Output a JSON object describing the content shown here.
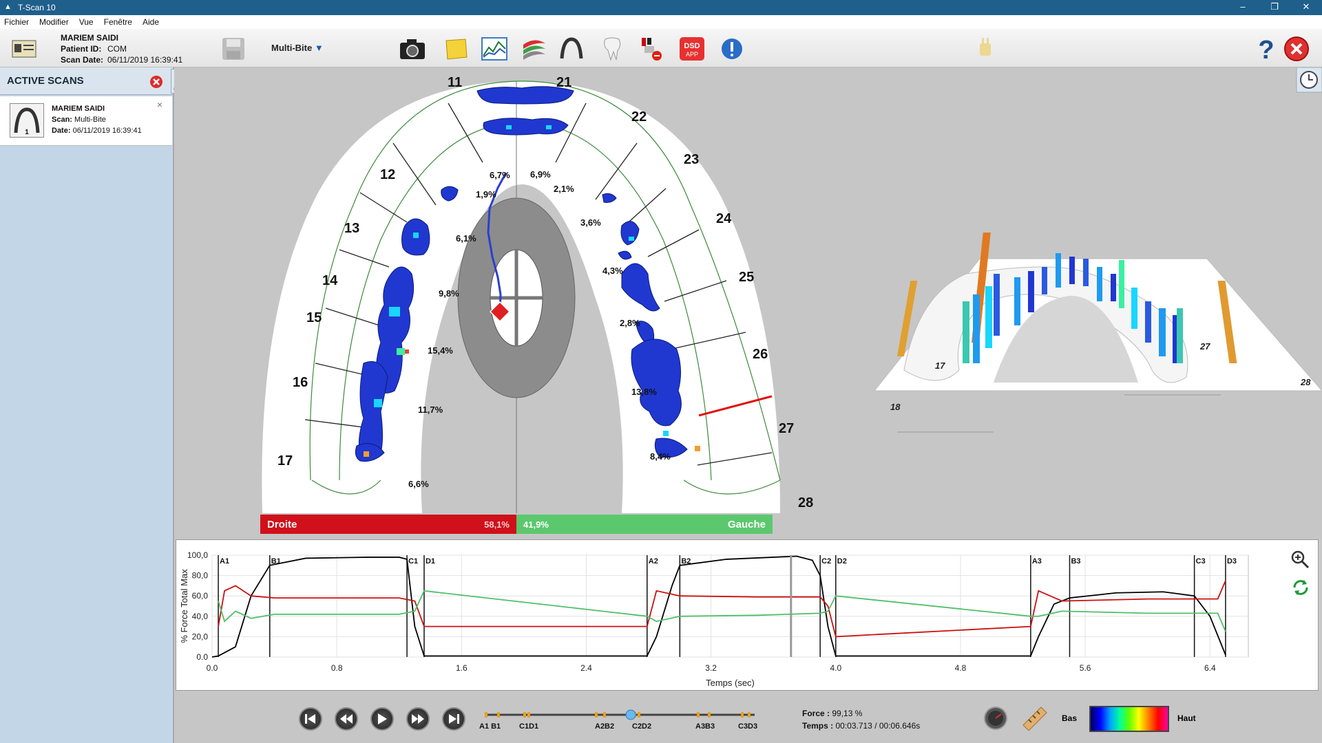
{
  "window": {
    "title": "T-Scan 10",
    "minimize": "–",
    "restore": "❐",
    "close": "✕"
  },
  "menu": [
    "Fichier",
    "Modifier",
    "Vue",
    "Fenêtre",
    "Aide"
  ],
  "patient": {
    "name": "MARIEM SAIDI",
    "id_label": "Patient ID:",
    "id": "COM",
    "date_label": "Scan Date:",
    "date": "06/11/2019 16:39:41"
  },
  "toolbar": {
    "mode": "Multi-Bite"
  },
  "active_scans": {
    "title": "ACTIVE SCANS",
    "card": {
      "name": "MARIEM SAIDI",
      "scan_label": "Scan:",
      "scan": "Multi-Bite",
      "date_label": "Date:",
      "date": "06/11/2019 16:39:41",
      "index": "1"
    }
  },
  "teeth_right": [
    "11",
    "12",
    "13",
    "14",
    "15",
    "16",
    "17"
  ],
  "teeth_left": [
    "21",
    "22",
    "23",
    "24",
    "25",
    "26",
    "27",
    "28"
  ],
  "arch_right_pct": [
    "6,7%",
    "1,9%",
    "6,1%",
    "9,8%",
    "15,4%",
    "11,7%",
    "6,6%"
  ],
  "arch_left_pct": [
    "6,9%",
    "2,1%",
    "3,6%",
    "4,3%",
    "2,8%",
    "13,8%",
    "8,4%"
  ],
  "balance": {
    "right_label": "Droite",
    "right_value": "58,1%",
    "left_value": "41,9%",
    "left_label": "Gauche",
    "right_color": "#d0101a",
    "left_color": "#5cc86e"
  },
  "view3d_labels": [
    "17",
    "18",
    "27",
    "28"
  ],
  "chart_data": {
    "type": "line",
    "ylabel": "% Force Total Max",
    "xlabel": "Temps (sec)",
    "xlim": [
      0.0,
      6.646
    ],
    "ylim": [
      0.0,
      100.0
    ],
    "xticks": [
      "0.0",
      "0.8",
      "1.6",
      "2.4",
      "3.2",
      "4.0",
      "4.8",
      "5.6",
      "6.4"
    ],
    "yticks": [
      "0.0",
      "20,0",
      "40,0",
      "60,0",
      "80,0",
      "100,0"
    ],
    "markers": [
      {
        "label": "A1",
        "x": 0.04
      },
      {
        "label": "B1",
        "x": 0.37
      },
      {
        "label": "C1",
        "x": 1.25
      },
      {
        "label": "D1",
        "x": 1.36
      },
      {
        "label": "A2",
        "x": 2.79
      },
      {
        "label": "B2",
        "x": 3.0
      },
      {
        "label": "C2",
        "x": 3.9
      },
      {
        "label": "D2",
        "x": 4.0
      },
      {
        "label": "A3",
        "x": 5.25
      },
      {
        "label": "B3",
        "x": 5.5
      },
      {
        "label": "C3",
        "x": 6.3
      },
      {
        "label": "D3",
        "x": 6.5
      }
    ],
    "cursor_x": 3.713,
    "series": [
      {
        "color": "#000000",
        "x": [
          0.0,
          0.04,
          0.15,
          0.25,
          0.37,
          0.6,
          1.0,
          1.2,
          1.25,
          1.3,
          1.36,
          2.79,
          2.85,
          2.95,
          3.0,
          3.3,
          3.6,
          3.75,
          3.85,
          3.9,
          3.95,
          4.0,
          5.25,
          5.3,
          5.4,
          5.5,
          5.8,
          6.1,
          6.3,
          6.4,
          6.5
        ],
        "y": [
          0,
          1,
          10,
          60,
          90,
          97,
          98,
          98,
          96,
          30,
          1,
          1,
          20,
          70,
          90,
          96,
          98,
          99,
          95,
          80,
          30,
          1,
          1,
          20,
          52,
          58,
          63,
          64,
          60,
          40,
          2
        ]
      },
      {
        "color": "#cc1010",
        "x": [
          0.04,
          0.08,
          0.15,
          0.25,
          0.4,
          1.2,
          1.3,
          1.36,
          2.79,
          2.85,
          3.0,
          3.5,
          3.9,
          3.95,
          4.0,
          5.25,
          5.3,
          5.45,
          6.0,
          6.45,
          6.5
        ],
        "y": [
          30,
          65,
          70,
          60,
          58,
          58,
          55,
          30,
          30,
          65,
          60,
          59,
          59,
          50,
          20,
          30,
          65,
          55,
          57,
          57,
          75
        ]
      },
      {
        "color": "#4fbf6a",
        "x": [
          0.04,
          0.08,
          0.15,
          0.25,
          0.4,
          1.2,
          1.3,
          1.36,
          2.79,
          2.85,
          3.0,
          3.5,
          3.9,
          3.95,
          4.0,
          5.25,
          5.3,
          5.45,
          6.0,
          6.45,
          6.5
        ],
        "y": [
          55,
          35,
          45,
          38,
          42,
          42,
          45,
          65,
          40,
          35,
          40,
          41,
          43,
          45,
          60,
          40,
          40,
          45,
          43,
          43,
          25
        ]
      }
    ]
  },
  "playback": {
    "force_label": "Force :",
    "force": "99,13 %",
    "time_label": "Temps :",
    "time": "00:03.713 / 00:06.646s",
    "marker_labels": [
      "A1 B1",
      "C1D1",
      "A2B2",
      "C2D2",
      "A3B3",
      "C3D3"
    ]
  },
  "legend": {
    "low": "Bas",
    "high": "Haut"
  }
}
